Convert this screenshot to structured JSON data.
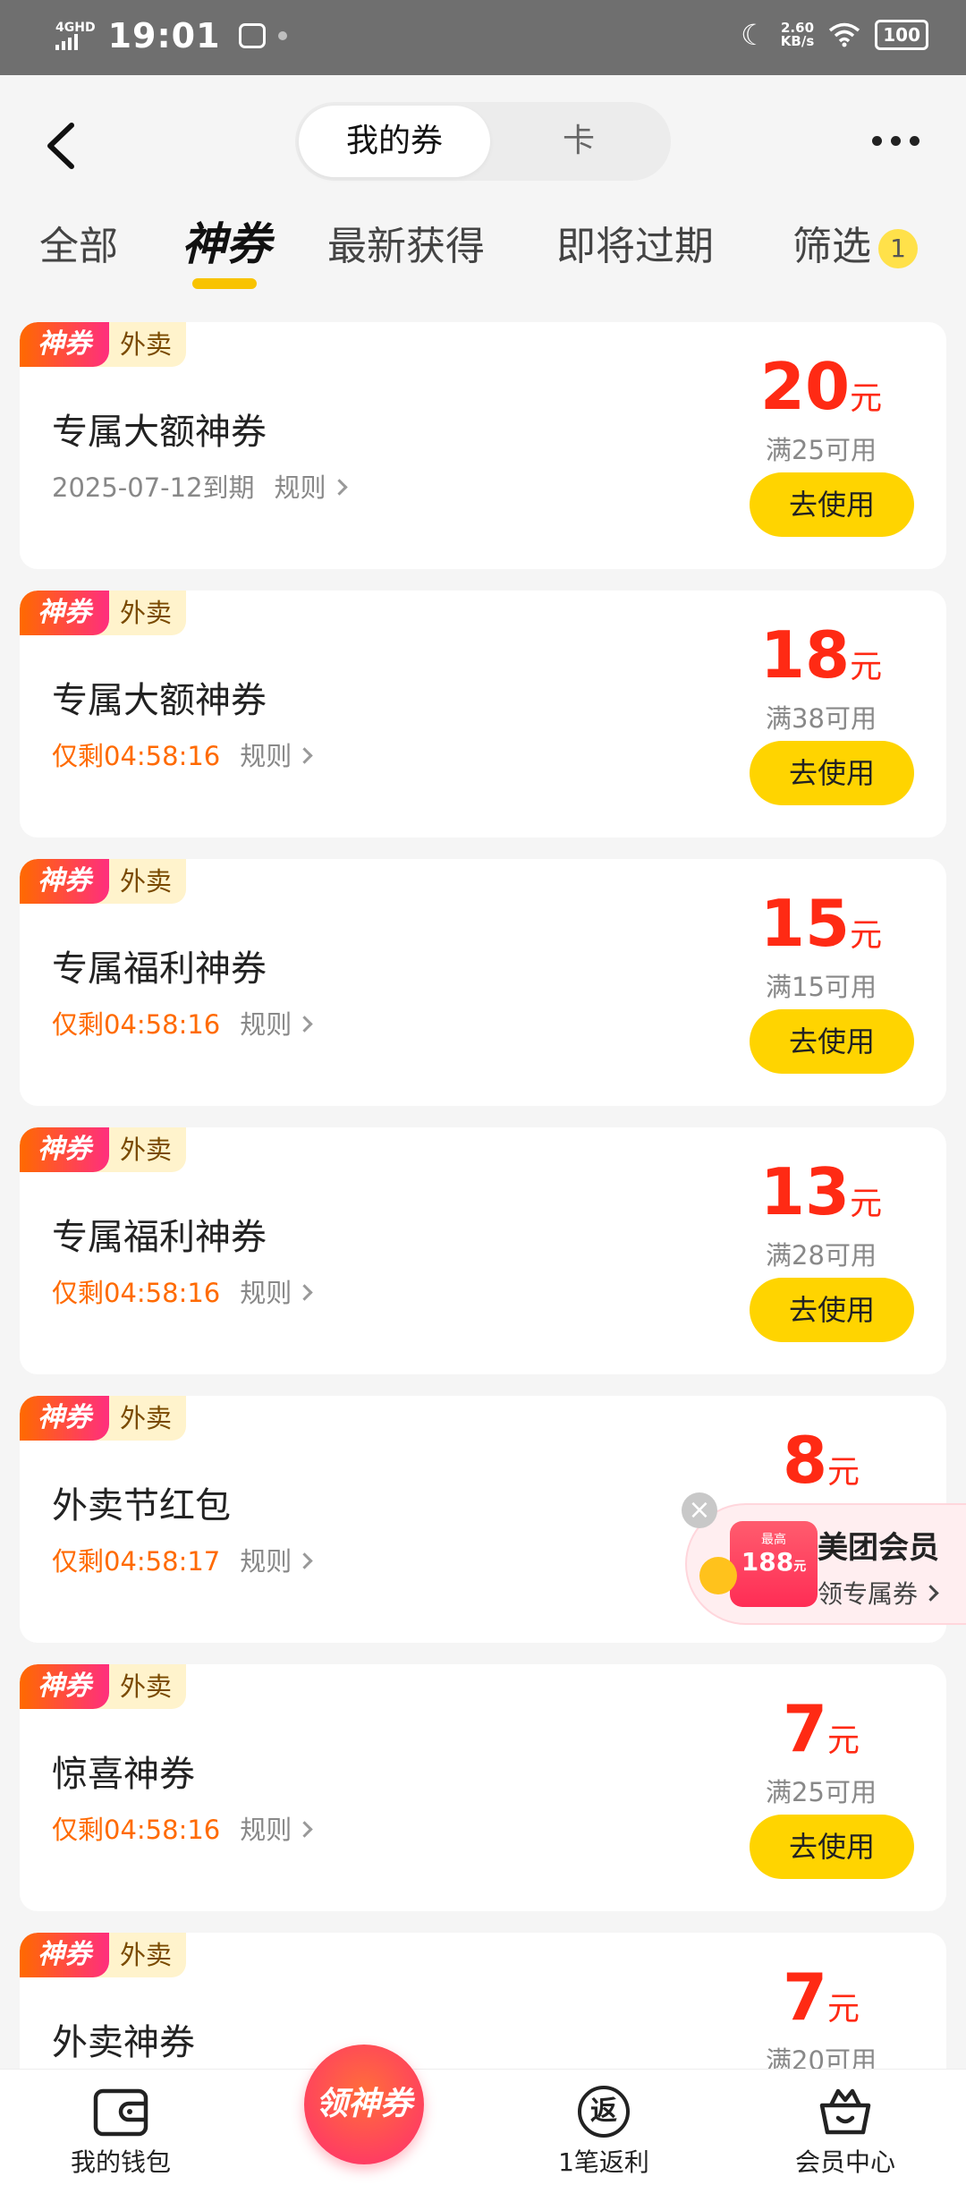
{
  "status_bar": {
    "network": "4GHD",
    "time": "19:01",
    "speed_value": "2.60",
    "speed_unit": "KB/s",
    "battery": "100"
  },
  "header": {
    "segment": {
      "active": "我的券",
      "inactive": "卡"
    },
    "tabs": [
      {
        "label": "全部"
      },
      {
        "label": "神券"
      },
      {
        "label": "最新获得"
      },
      {
        "label": "即将过期"
      },
      {
        "label": "筛选"
      }
    ],
    "active_tab_index": 1,
    "filter_count": "1"
  },
  "coupon_tag": {
    "brand": "神券",
    "category": "外卖"
  },
  "coupons": [
    {
      "title": "专属大额神券",
      "expiry": "2025-07-12到期",
      "rule": "规则",
      "amount": "20",
      "unit": "元",
      "condition": "满25可用",
      "action": "去使用"
    },
    {
      "title": "专属大额神券",
      "countdown": "仅剩04:58:16",
      "rule": "规则",
      "amount": "18",
      "unit": "元",
      "condition": "满38可用",
      "action": "去使用"
    },
    {
      "title": "专属福利神券",
      "countdown": "仅剩04:58:16",
      "rule": "规则",
      "amount": "15",
      "unit": "元",
      "condition": "满15可用",
      "action": "去使用"
    },
    {
      "title": "专属福利神券",
      "countdown": "仅剩04:58:16",
      "rule": "规则",
      "amount": "13",
      "unit": "元",
      "condition": "满28可用",
      "action": "去使用"
    },
    {
      "title": "外卖节红包",
      "countdown": "仅剩04:58:17",
      "rule": "规则",
      "amount": "8",
      "unit": "元"
    },
    {
      "title": "惊喜神券",
      "countdown": "仅剩04:58:16",
      "rule": "规则",
      "amount": "7",
      "unit": "元",
      "condition": "满25可用",
      "action": "去使用"
    },
    {
      "title": "外卖神券",
      "amount": "7",
      "unit": "元",
      "condition": "满20可用"
    }
  ],
  "member_float": {
    "card_top": "最高",
    "card_amount": "188",
    "card_unit": "元",
    "title": "美团会员",
    "subtitle": "领专属券"
  },
  "bottom_nav": {
    "wallet": "我的钱包",
    "center": "领神券",
    "rebate": "1笔返利",
    "rebate_icon": "返",
    "member": "会员中心"
  },
  "colors": {
    "accent_yellow": "#ffd400",
    "price_red": "#ff2a14",
    "countdown_orange": "#ff6a00"
  }
}
